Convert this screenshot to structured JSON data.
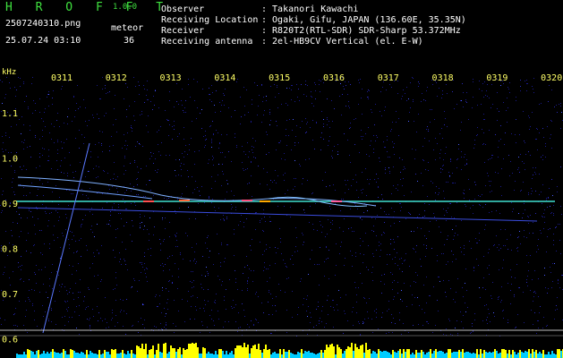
{
  "app": {
    "logo": "H R O F F T",
    "version": "1.0.0",
    "filename": "2507240310.png",
    "datetime": "25.07.24 03:10",
    "meteor_label": "meteor",
    "meteor_count": "36"
  },
  "info": [
    {
      "label": "Observer",
      "value": ": Takanori Kawachi"
    },
    {
      "label": "Receiving Location",
      "value": ": Ogaki, Gifu, JAPAN (136.60E, 35.35N)"
    },
    {
      "label": "Receiver",
      "value": ": R820T2(RTL-SDR) SDR-Sharp 53.372MHz"
    },
    {
      "label": "Receiving antenna",
      "value": ": 2el-HB9CV Vertical (el. E-W)"
    }
  ],
  "axis": {
    "unit": "kHz",
    "time_ticks": [
      "0311",
      "0312",
      "0313",
      "0314",
      "0315",
      "0316",
      "0317",
      "0318",
      "0319",
      "0320"
    ],
    "freq_ticks": [
      "1.1",
      "1.0",
      "0.9",
      "0.8",
      "0.7",
      "0.6"
    ]
  },
  "colors": {
    "text": "#ffffff",
    "logo": "#3fe03f",
    "tick_labels": "#ffff66",
    "background": "#000000",
    "noise": "#1a1a8c",
    "carrier": "#40e0d0",
    "level_bar": "#ffff00",
    "level_bar_low": "#00ccff"
  }
}
